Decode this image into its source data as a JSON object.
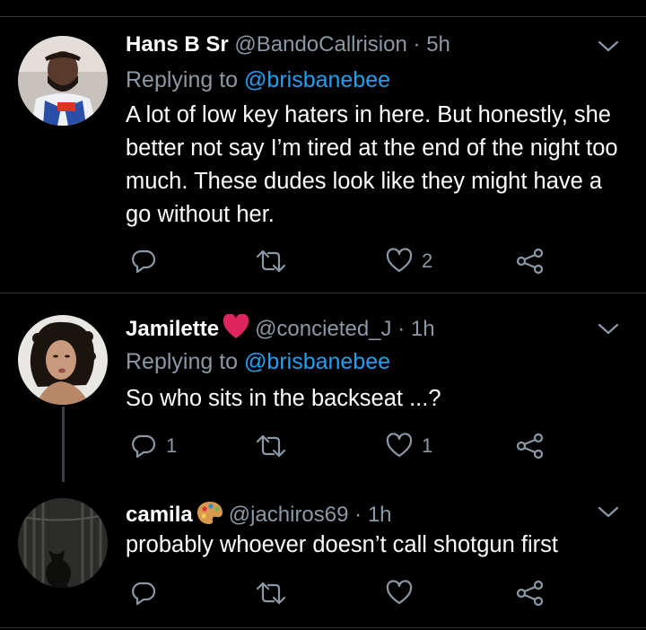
{
  "tweets": [
    {
      "name": "Hans B Sr",
      "handle": "@BandoCallrision",
      "separator": "·",
      "time": "5h",
      "replying_prefix": "Replying to",
      "replying_to": "@brisbanebee",
      "text": "A lot of low key haters in here. But honestly, she better not say I’m tired at the end of the night too much. These dudes look like they might have a go without her.",
      "reply_count": "",
      "retweet_count": "",
      "like_count": "2"
    },
    {
      "name": "Jamilette",
      "name_emoji": "red-heart-icon",
      "handle": "@concieted_J",
      "separator": "·",
      "time": "1h",
      "replying_prefix": "Replying to",
      "replying_to": "@brisbanebee",
      "text": "So who sits in the backseat ...?",
      "reply_count": "1",
      "retweet_count": "",
      "like_count": "1"
    },
    {
      "name": "camila",
      "name_emoji": "artist-palette-icon",
      "handle": "@jachiros69",
      "separator": "·",
      "time": "1h",
      "text": "probably whoever doesn’t call shotgun first",
      "reply_count": "",
      "retweet_count": "",
      "like_count": ""
    }
  ],
  "colors": {
    "background": "#000000",
    "primary_text": "#ffffff",
    "secondary_text": "#8b98a5",
    "link": "#1da1f2",
    "divider": "#2f3336",
    "heart_emoji": "#e0245e"
  }
}
